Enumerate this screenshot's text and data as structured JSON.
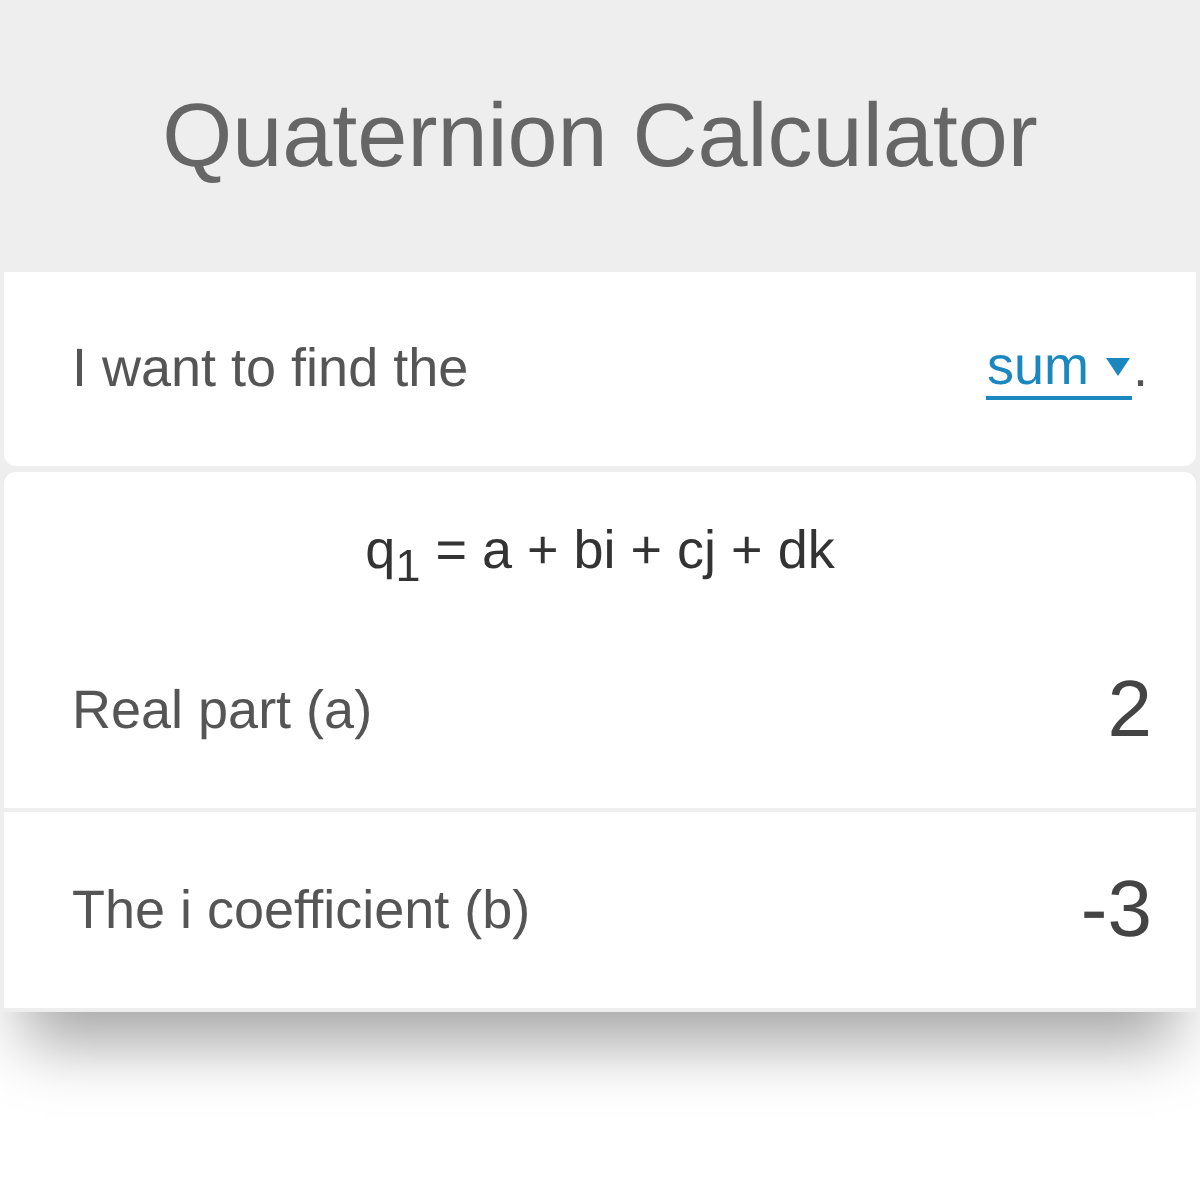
{
  "header": {
    "title": "Quaternion Calculator"
  },
  "mode": {
    "label": "I want to find the",
    "value": "sum",
    "suffix": "."
  },
  "formula": "q$_{1}$ = a + bi + cj + dk",
  "fields": [
    {
      "label": "Real part (a)",
      "value": "2"
    },
    {
      "label": "The i coefficient (b)",
      "value": "-3"
    }
  ]
}
